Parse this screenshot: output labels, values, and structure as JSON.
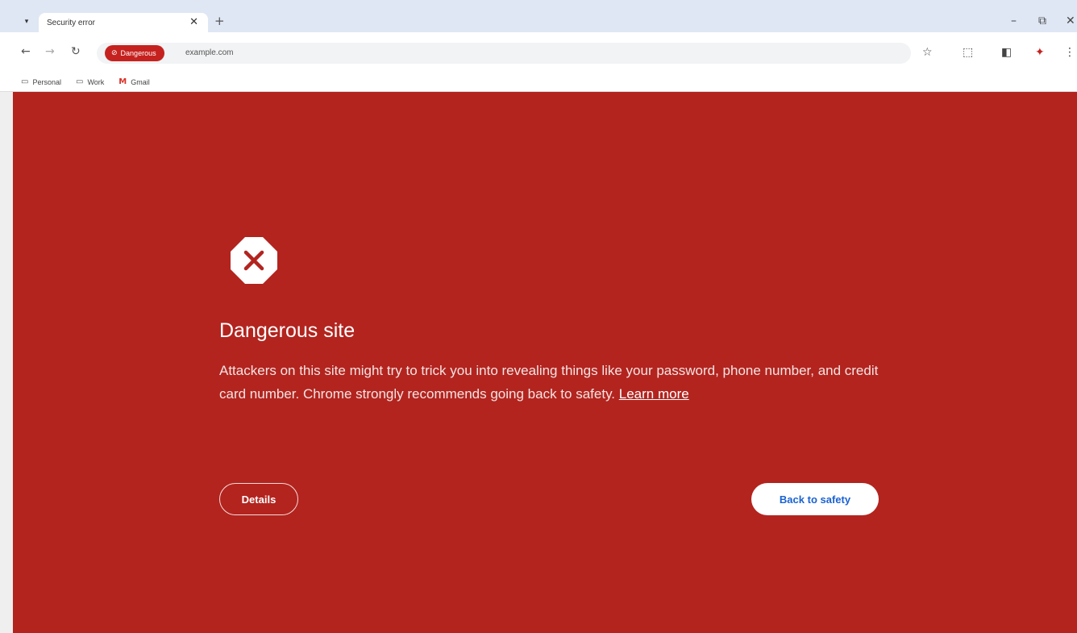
{
  "browser": {
    "tab_search_icon": "▾",
    "tab_title": "Security error",
    "tab_close": "✕",
    "new_tab": "+",
    "controls": {
      "minimize": "–",
      "restore": "⧉",
      "close": "✕"
    },
    "nav": {
      "back": "←",
      "forward": "→",
      "reload": "↻"
    },
    "omnibox": {
      "chip_icon": "⊘",
      "chip_label": "Dangerous",
      "url": "example.com"
    },
    "toolbar_icons": {
      "star": "☆",
      "extension": "⬚",
      "sidepanel": "◧",
      "profile": "✦",
      "menu": "⋮"
    },
    "bookmarks": [
      {
        "icon": "▭",
        "label": "Personal"
      },
      {
        "icon": "▭",
        "label": "Work"
      },
      {
        "icon": "M",
        "label": "Gmail"
      }
    ]
  },
  "interstitial": {
    "title": "Dangerous site",
    "description": "Attackers on this site might try to trick you into revealing things like your password, phone number, and credit card number. Chrome strongly recommends going back to safety.",
    "learn_more": "Learn more",
    "details_button": "Details",
    "back_button": "Back to safety"
  },
  "colors": {
    "danger_background": "#b3241f",
    "chip": "#c5221f",
    "primary_button_text": "#1a62d2"
  }
}
